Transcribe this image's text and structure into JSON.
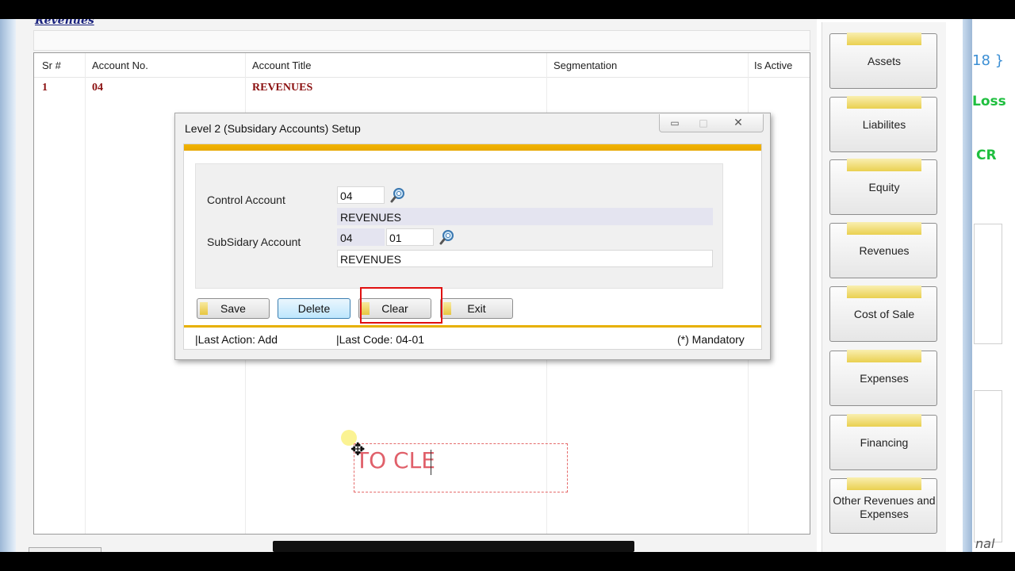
{
  "main": {
    "heading": "Revenues",
    "columns": [
      "Sr #",
      "Account No.",
      "Account Title",
      "Segmentation",
      "Is Active"
    ],
    "rows": [
      {
        "sr": "1",
        "account_no": "04",
        "title": "REVENUES",
        "segmentation": "",
        "active": ""
      }
    ]
  },
  "dialog": {
    "title": "Level 2 (Subsidary Accounts) Setup",
    "window_buttons": {
      "minimize": "▭",
      "maximize": "□",
      "close": "✕"
    },
    "control_account": {
      "label": "Control Account",
      "code": "04",
      "name": "REVENUES"
    },
    "subsidiary_account": {
      "label": "SubSidary Account",
      "prefix": "04",
      "code": "01",
      "name": "REVENUES"
    },
    "buttons": {
      "save": "Save",
      "delete": "Delete",
      "clear": "Clear",
      "exit": "Exit"
    },
    "status": {
      "last_action": "|Last Action: Add",
      "last_code": "|Last Code: 04-01",
      "mandatory": "(*) Mandatory"
    }
  },
  "nav": {
    "items": [
      "Assets",
      "Liabilites",
      "Equity",
      "Revenues",
      "Cost of Sale",
      "Expenses",
      "Financing",
      "Other Revenues and Expenses"
    ]
  },
  "right_edge": {
    "t1": "18 }",
    "t2": "Loss",
    "t3": "CR",
    "t4": "nal"
  },
  "overlay": {
    "text": "TO CLE"
  },
  "colors": {
    "accent_gold": "#e7a800",
    "title_red": "#8b1010",
    "highlight_red": "#e01010"
  }
}
